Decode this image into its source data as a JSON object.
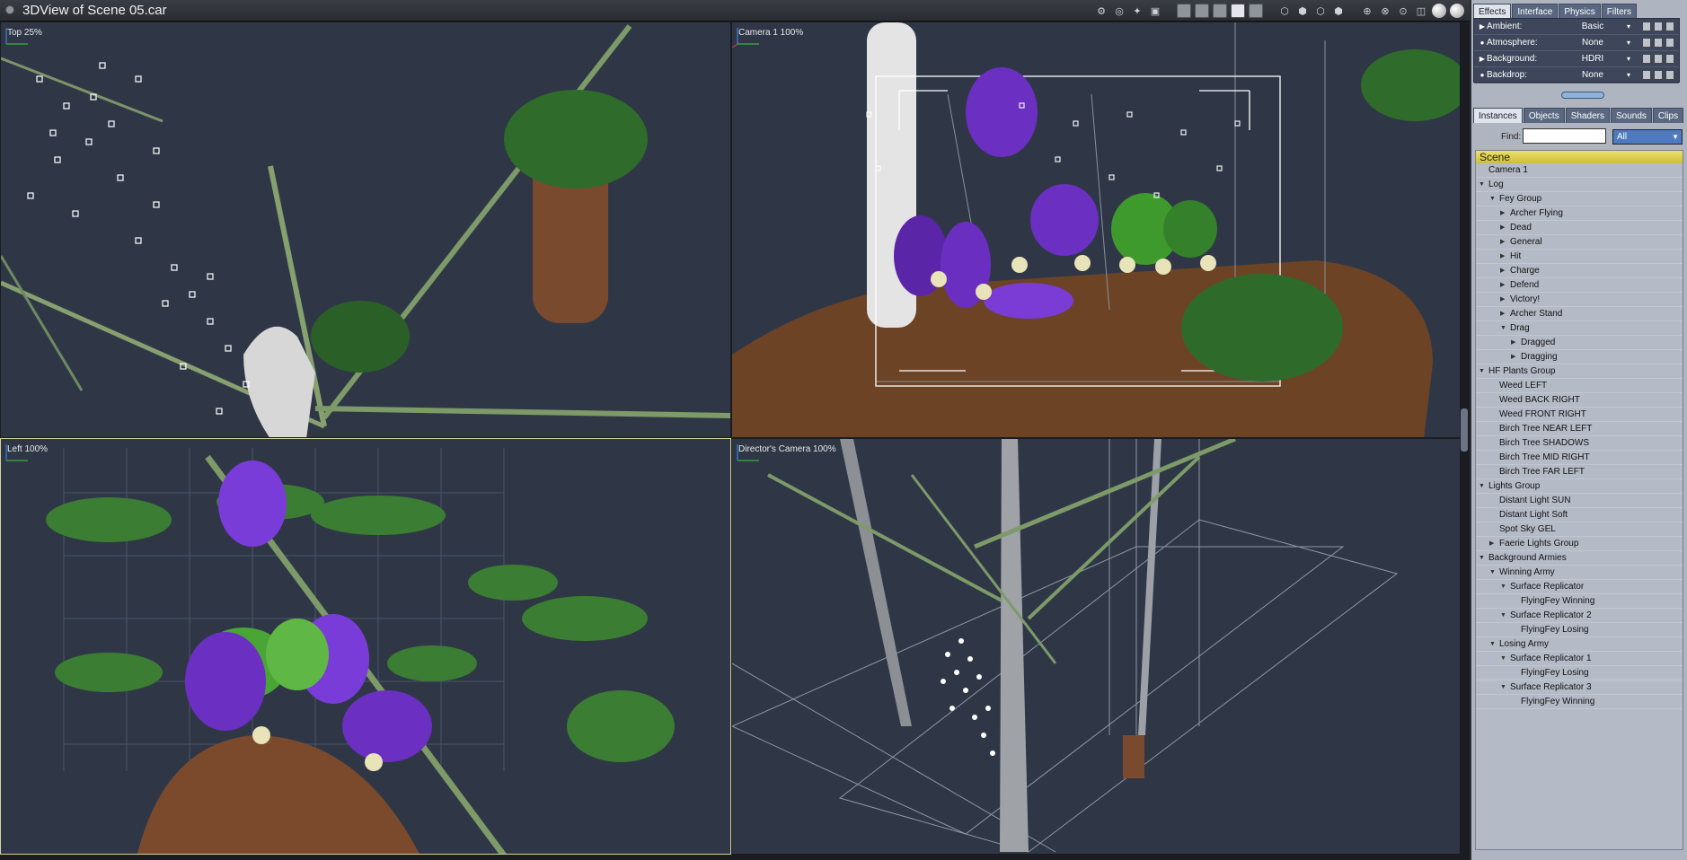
{
  "window": {
    "title": "3DView of Scene 05.car"
  },
  "toolbar": {
    "icons": [
      "scene-icon",
      "camera-icon",
      "light-icon",
      "render-icon",
      "layout-1-icon",
      "layout-2-icon",
      "layout-3-icon",
      "layout-4-icon",
      "layout-5-icon",
      "shading-1-icon",
      "shading-2-icon",
      "shading-3-icon",
      "shading-4-icon",
      "move-icon",
      "rotate-icon",
      "scale-icon",
      "box-icon",
      "sphere-shaded-icon",
      "sphere-lit-icon"
    ]
  },
  "viewports": {
    "top": {
      "label": "Top 25%"
    },
    "camera1": {
      "label": "Camera 1 100%"
    },
    "left": {
      "label": "Left 100%"
    },
    "director": {
      "label": "Director's Camera 100%"
    }
  },
  "panel": {
    "top_tabs": [
      "Effects",
      "Interface",
      "Physics",
      "Filters"
    ],
    "effects": [
      {
        "name": "Ambient:",
        "value": "Basic",
        "marker": "triangle"
      },
      {
        "name": "Atmosphere:",
        "value": "None",
        "marker": "dot"
      },
      {
        "name": "Background:",
        "value": "HDRI",
        "marker": "triangle"
      },
      {
        "name": "Backdrop:",
        "value": "None",
        "marker": "dot"
      }
    ],
    "bottom_tabs": [
      "Instances",
      "Objects",
      "Shaders",
      "Sounds",
      "Clips"
    ],
    "find": {
      "label": "Find:",
      "value": "",
      "filter": "All"
    },
    "tree": {
      "root": "Scene",
      "nodes": [
        {
          "label": "Camera 1",
          "depth": 0,
          "toggle": ""
        },
        {
          "label": "Log",
          "depth": 0,
          "toggle": "open"
        },
        {
          "label": "Fey Group",
          "depth": 1,
          "toggle": "open"
        },
        {
          "label": "Archer Flying",
          "depth": 2,
          "toggle": "closed"
        },
        {
          "label": "Dead",
          "depth": 2,
          "toggle": "closed"
        },
        {
          "label": "General",
          "depth": 2,
          "toggle": "closed"
        },
        {
          "label": "Hit",
          "depth": 2,
          "toggle": "closed"
        },
        {
          "label": "Charge",
          "depth": 2,
          "toggle": "closed"
        },
        {
          "label": "Defend",
          "depth": 2,
          "toggle": "closed"
        },
        {
          "label": "Victory!",
          "depth": 2,
          "toggle": "closed"
        },
        {
          "label": "Archer Stand",
          "depth": 2,
          "toggle": "closed"
        },
        {
          "label": "Drag",
          "depth": 2,
          "toggle": "open"
        },
        {
          "label": "Dragged",
          "depth": 3,
          "toggle": "closed"
        },
        {
          "label": "Dragging",
          "depth": 3,
          "toggle": "closed"
        },
        {
          "label": "HF Plants Group",
          "depth": 0,
          "toggle": "open"
        },
        {
          "label": "Weed LEFT",
          "depth": 1,
          "toggle": ""
        },
        {
          "label": "Weed BACK RIGHT",
          "depth": 1,
          "toggle": ""
        },
        {
          "label": "Weed FRONT RIGHT",
          "depth": 1,
          "toggle": ""
        },
        {
          "label": "Birch Tree NEAR LEFT",
          "depth": 1,
          "toggle": ""
        },
        {
          "label": "Birch Tree SHADOWS",
          "depth": 1,
          "toggle": ""
        },
        {
          "label": "Birch Tree MID RIGHT",
          "depth": 1,
          "toggle": ""
        },
        {
          "label": "Birch Tree FAR LEFT",
          "depth": 1,
          "toggle": ""
        },
        {
          "label": "Lights Group",
          "depth": 0,
          "toggle": "open"
        },
        {
          "label": "Distant Light SUN",
          "depth": 1,
          "toggle": ""
        },
        {
          "label": "Distant Light Soft",
          "depth": 1,
          "toggle": ""
        },
        {
          "label": "Spot Sky GEL",
          "depth": 1,
          "toggle": ""
        },
        {
          "label": "Faerie Lights Group",
          "depth": 1,
          "toggle": "closed"
        },
        {
          "label": "Background Armies",
          "depth": 0,
          "toggle": "open"
        },
        {
          "label": "Winning Army",
          "depth": 1,
          "toggle": "open"
        },
        {
          "label": "Surface Replicator",
          "depth": 2,
          "toggle": "open"
        },
        {
          "label": "FlyingFey Winning",
          "depth": 3,
          "toggle": ""
        },
        {
          "label": "Surface Replicator 2",
          "depth": 2,
          "toggle": "open"
        },
        {
          "label": "FlyingFey Losing",
          "depth": 3,
          "toggle": ""
        },
        {
          "label": "Losing Army",
          "depth": 1,
          "toggle": "open"
        },
        {
          "label": "Surface Replicator 1",
          "depth": 2,
          "toggle": "open"
        },
        {
          "label": "FlyingFey Losing",
          "depth": 3,
          "toggle": ""
        },
        {
          "label": "Surface Replicator 3",
          "depth": 2,
          "toggle": "open"
        },
        {
          "label": "FlyingFey Winning",
          "depth": 3,
          "toggle": ""
        }
      ]
    }
  }
}
